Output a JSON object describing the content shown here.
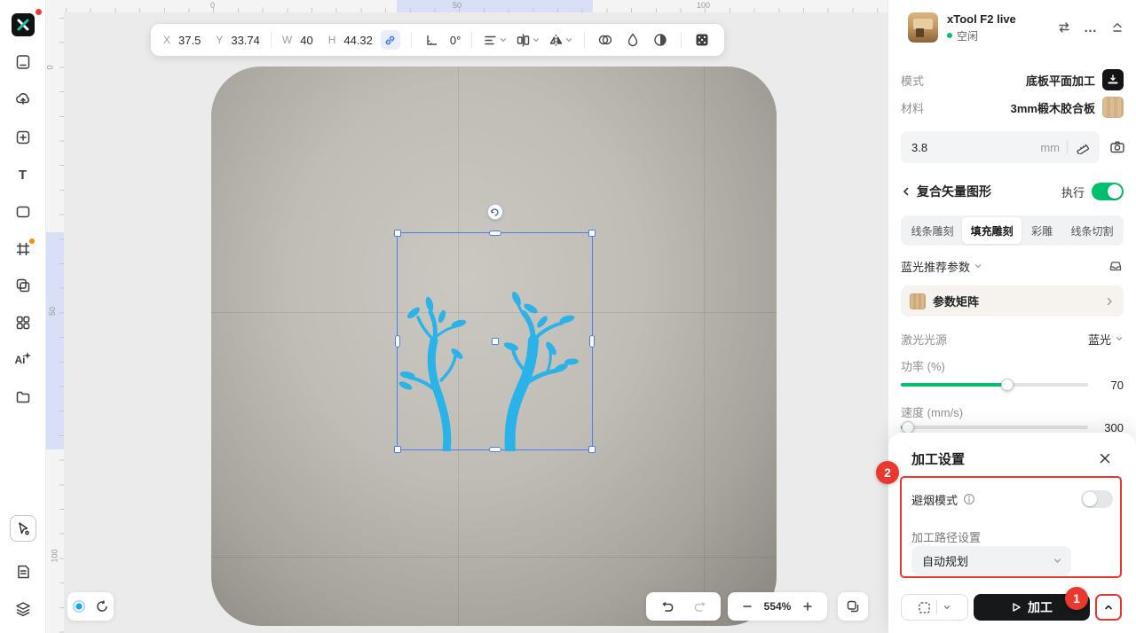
{
  "toolbar": {
    "x_label": "X",
    "x_value": "37.5",
    "y_label": "Y",
    "y_value": "33.74",
    "w_label": "W",
    "w_value": "40",
    "h_label": "H",
    "h_value": "44.32",
    "angle_value": "0°"
  },
  "canvas": {
    "ruler_top": [
      "0",
      "50",
      "100"
    ],
    "ruler_left": [
      "0",
      "50",
      "100"
    ]
  },
  "zoom_controls": {
    "value": "554%"
  },
  "sidebar": {
    "text_tool_glyph": "T",
    "ai_tool_glyph": "Ai"
  },
  "device": {
    "name": "xTool F2 live",
    "status": "空闲"
  },
  "processing": {
    "mode_label": "模式",
    "mode_value": "底板平面加工",
    "material_label": "材料",
    "material_value": "3mm椴木胶合板",
    "thickness_value": "3.8",
    "thickness_unit": "mm"
  },
  "layer": {
    "title": "复合矢量图形",
    "execute_label": "执行",
    "tabs": [
      {
        "label": "线条雕刻"
      },
      {
        "label": "填充雕刻"
      },
      {
        "label": "彩雕"
      },
      {
        "label": "线条切割"
      }
    ],
    "selected_tab": "填充雕刻",
    "preset_label": "蓝光推荐参数",
    "matrix_label": "参数矩阵",
    "laser_label": "激光光源",
    "laser_value": "蓝光",
    "power_label": "功率 (%)",
    "power_value": "70",
    "speed_label": "速度 (mm/s)",
    "speed_value": "300"
  },
  "modal": {
    "title": "加工设置",
    "smoke_label": "避烟模式",
    "path_label": "加工路径设置",
    "path_value": "自动规划"
  },
  "actions": {
    "process_label": "加工"
  },
  "annotations": {
    "step1": "1",
    "step2": "2"
  },
  "colors": {
    "accent_green": "#00c06e",
    "selection_blue": "#4a7df0",
    "graphic_blue": "#2ab3e8",
    "annotation_red": "#ea382e"
  }
}
